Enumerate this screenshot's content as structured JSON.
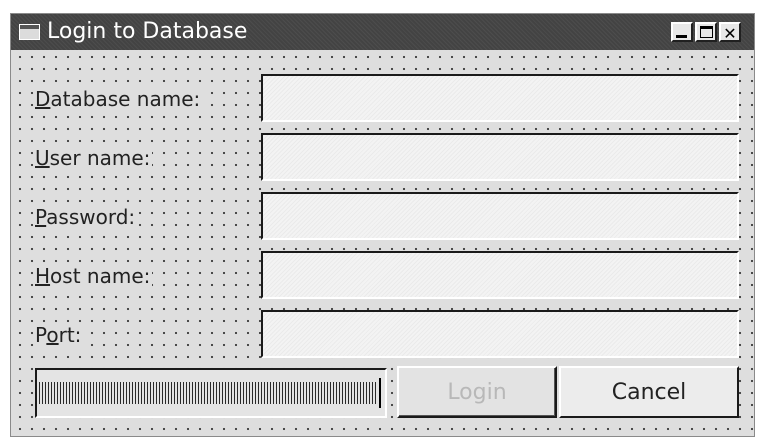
{
  "window": {
    "title": "Login to Database",
    "icon": "window-icon",
    "controls": {
      "minimize_icon": "minimize-icon",
      "maximize_icon": "maximize-icon",
      "close_icon": "close-icon",
      "close_glyph": "✕"
    }
  },
  "fields": [
    {
      "label_mnemonic": "D",
      "label_rest": "atabase name:",
      "value": ""
    },
    {
      "label_mnemonic": "U",
      "label_rest": "ser name:",
      "value": ""
    },
    {
      "label_mnemonic": "P",
      "label_rest": "assword:",
      "value": ""
    },
    {
      "label_mnemonic": "H",
      "label_rest": "ost name:",
      "value": ""
    },
    {
      "label_pre": "P",
      "label_mnemonic": "o",
      "label_rest": "rt:",
      "value": ""
    }
  ],
  "progress": {
    "value_percent": 100
  },
  "buttons": {
    "login_label": "Login",
    "login_enabled": false,
    "cancel_label": "Cancel"
  },
  "colors": {
    "titlebar": "#434343",
    "window_background": "#dedede",
    "disabled_text": "#b8b8b8"
  }
}
